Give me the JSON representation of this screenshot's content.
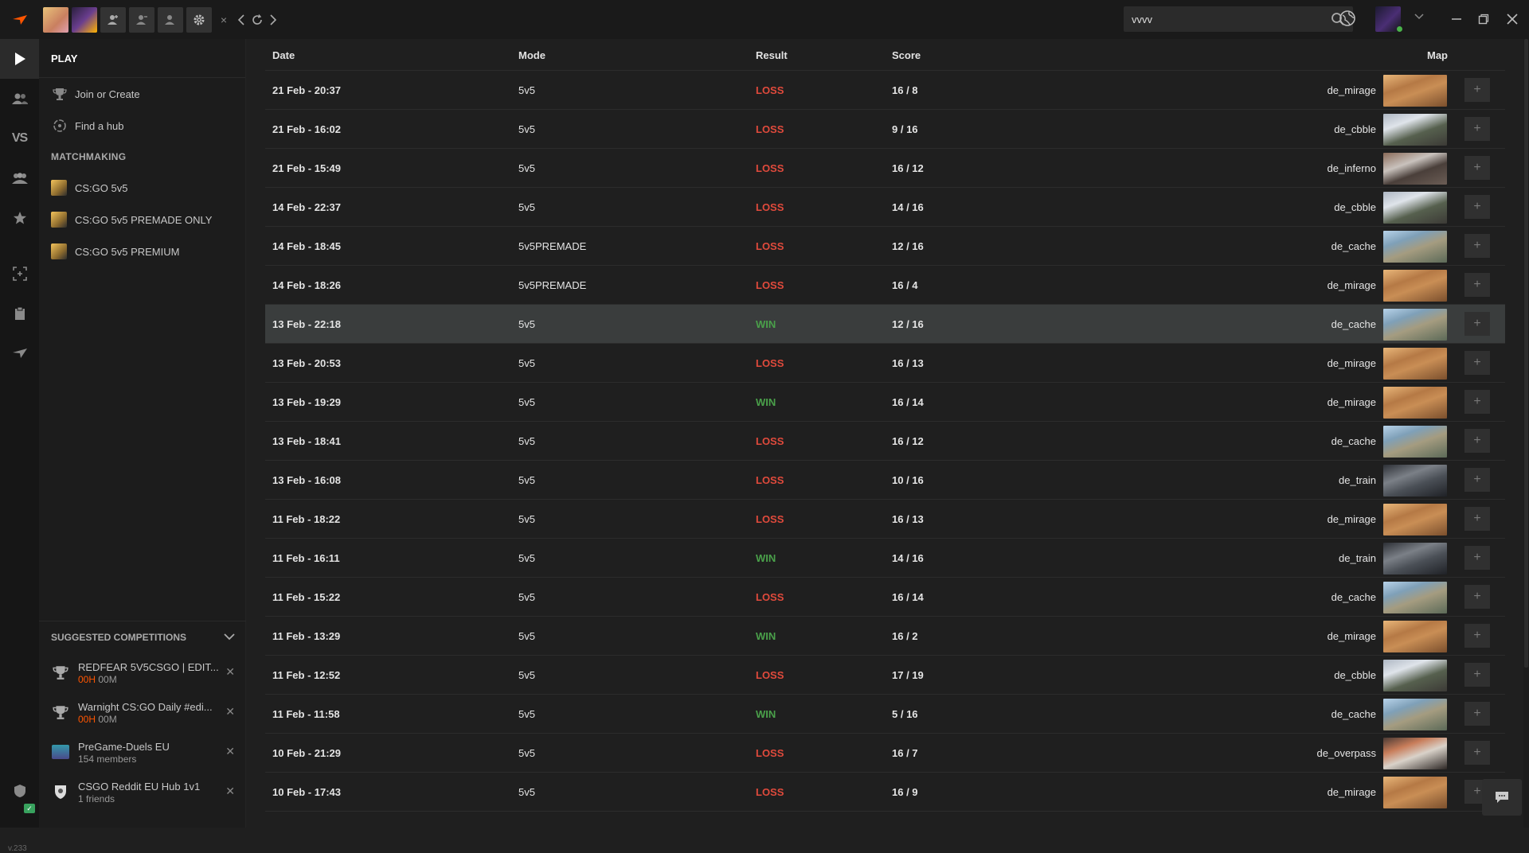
{
  "topbar": {
    "search_value": "vvvv",
    "close_tab": "×"
  },
  "sidebar": {
    "play_label": "PLAY",
    "join_create": "Join or Create",
    "find_hub": "Find a hub",
    "matchmaking_label": "MATCHMAKING",
    "queues": [
      "CS:GO 5v5",
      "CS:GO 5v5 PREMADE ONLY",
      "CS:GO 5v5 PREMIUM"
    ],
    "suggested_label": "SUGGESTED COMPETITIONS",
    "suggested": [
      {
        "title": "REDFEAR 5V5CSGO | EDIT...",
        "timer_h": "00H",
        "timer_m": "00M"
      },
      {
        "title": "Warnight CS:GO Daily #edi...",
        "timer_h": "00H",
        "timer_m": "00M"
      },
      {
        "title": "PreGame-Duels EU",
        "sub": "154 members"
      },
      {
        "title": "CSGO Reddit EU Hub 1v1",
        "sub": "1 friends"
      }
    ],
    "version": "v.233"
  },
  "table": {
    "headers": {
      "date": "Date",
      "mode": "Mode",
      "result": "Result",
      "score": "Score",
      "map": "Map"
    },
    "rows": [
      {
        "date": "21 Feb - 20:37",
        "mode": "5v5",
        "result": "LOSS",
        "score": "16 / 8",
        "map": "de_mirage"
      },
      {
        "date": "21 Feb - 16:02",
        "mode": "5v5",
        "result": "LOSS",
        "score": "9 / 16",
        "map": "de_cbble"
      },
      {
        "date": "21 Feb - 15:49",
        "mode": "5v5",
        "result": "LOSS",
        "score": "16 / 12",
        "map": "de_inferno"
      },
      {
        "date": "14 Feb - 22:37",
        "mode": "5v5",
        "result": "LOSS",
        "score": "14 / 16",
        "map": "de_cbble"
      },
      {
        "date": "14 Feb - 18:45",
        "mode": "5v5PREMADE",
        "result": "LOSS",
        "score": "12 / 16",
        "map": "de_cache"
      },
      {
        "date": "14 Feb - 18:26",
        "mode": "5v5PREMADE",
        "result": "LOSS",
        "score": "16 / 4",
        "map": "de_mirage"
      },
      {
        "date": "13 Feb - 22:18",
        "mode": "5v5",
        "result": "WIN",
        "score": "12 / 16",
        "map": "de_cache"
      },
      {
        "date": "13 Feb - 20:53",
        "mode": "5v5",
        "result": "LOSS",
        "score": "16 / 13",
        "map": "de_mirage"
      },
      {
        "date": "13 Feb - 19:29",
        "mode": "5v5",
        "result": "WIN",
        "score": "16 / 14",
        "map": "de_mirage"
      },
      {
        "date": "13 Feb - 18:41",
        "mode": "5v5",
        "result": "LOSS",
        "score": "16 / 12",
        "map": "de_cache"
      },
      {
        "date": "13 Feb - 16:08",
        "mode": "5v5",
        "result": "LOSS",
        "score": "10 / 16",
        "map": "de_train"
      },
      {
        "date": "11 Feb - 18:22",
        "mode": "5v5",
        "result": "LOSS",
        "score": "16 / 13",
        "map": "de_mirage"
      },
      {
        "date": "11 Feb - 16:11",
        "mode": "5v5",
        "result": "WIN",
        "score": "14 / 16",
        "map": "de_train"
      },
      {
        "date": "11 Feb - 15:22",
        "mode": "5v5",
        "result": "LOSS",
        "score": "16 / 14",
        "map": "de_cache"
      },
      {
        "date": "11 Feb - 13:29",
        "mode": "5v5",
        "result": "WIN",
        "score": "16 / 2",
        "map": "de_mirage"
      },
      {
        "date": "11 Feb - 12:52",
        "mode": "5v5",
        "result": "LOSS",
        "score": "17 / 19",
        "map": "de_cbble"
      },
      {
        "date": "11 Feb - 11:58",
        "mode": "5v5",
        "result": "WIN",
        "score": "5 / 16",
        "map": "de_cache"
      },
      {
        "date": "10 Feb - 21:29",
        "mode": "5v5",
        "result": "LOSS",
        "score": "16 / 7",
        "map": "de_overpass"
      },
      {
        "date": "10 Feb - 17:43",
        "mode": "5v5",
        "result": "LOSS",
        "score": "16 / 9",
        "map": "de_mirage"
      }
    ],
    "highlighted_row": 6
  },
  "colors": {
    "accent": "#ff5500",
    "loss": "#e04a3c",
    "win": "#4aa04a"
  }
}
